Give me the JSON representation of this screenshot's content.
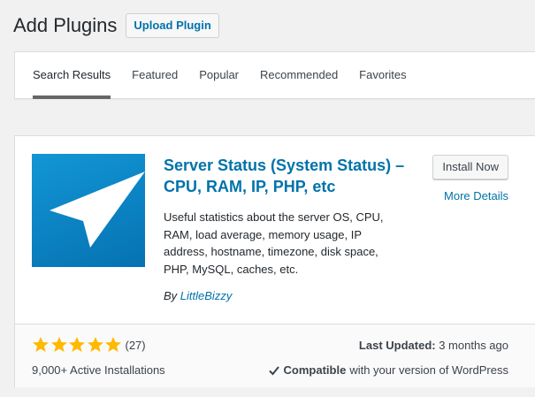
{
  "header": {
    "title": "Add Plugins",
    "upload_label": "Upload Plugin"
  },
  "tabs": [
    {
      "label": "Search Results",
      "current": true
    },
    {
      "label": "Featured"
    },
    {
      "label": "Popular"
    },
    {
      "label": "Recommended"
    },
    {
      "label": "Favorites"
    }
  ],
  "plugin": {
    "name": "Server Status (System Status) – CPU, RAM, IP, PHP, etc",
    "description": "Useful statistics about the server OS, CPU, RAM, load average, memory usage, IP address, hostname, timezone, disk space, PHP, MySQL, caches, etc.",
    "author_prefix": "By",
    "author": "LittleBizzy",
    "install_label": "Install Now",
    "more_details_label": "More Details",
    "icon": "paper-plane-arrow-icon",
    "icon_colors": [
      "#1296d5",
      "#0672b2"
    ],
    "rating_stars": 5,
    "rating_max": 5,
    "rating_count": "(27)",
    "star_color": "#ffb900",
    "active_installs": "9,000+ Active Installations",
    "last_updated_label": "Last Updated:",
    "last_updated_value": "3 months ago",
    "compatible_label": "Compatible",
    "compatible_text": "with your version of WordPress"
  },
  "colors": {
    "link": "#0073aa",
    "background": "#f1f1f1"
  }
}
